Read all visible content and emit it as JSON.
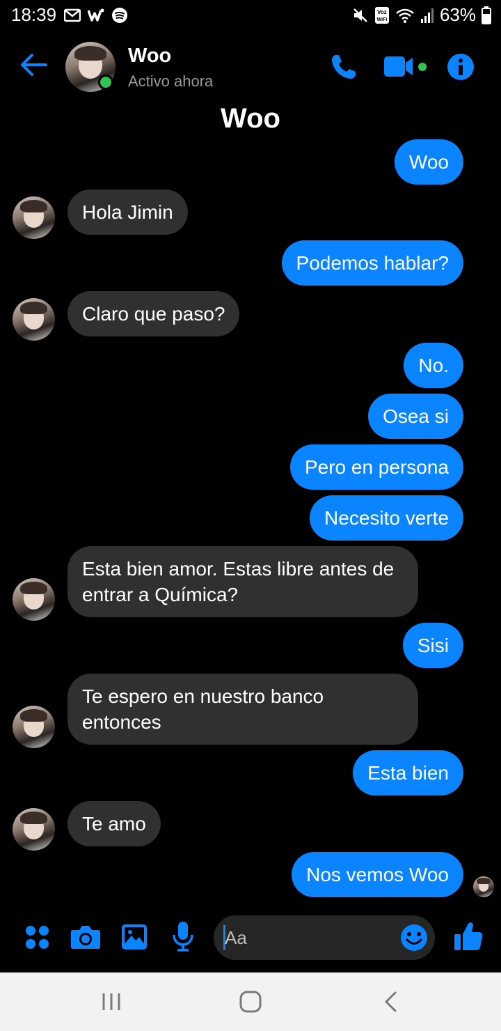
{
  "status_bar": {
    "time": "18:39",
    "battery": "63%",
    "left_icons": [
      "gmail-icon",
      "w-app-icon",
      "spotify-icon"
    ],
    "right_icons": [
      "mute-icon",
      "voz-wifi-icon",
      "wifi-icon",
      "signal-icon",
      "battery-icon"
    ]
  },
  "header": {
    "contact_name": "Woo",
    "status": "Activo ahora",
    "accent_color": "#0a84ff",
    "online_color": "#31c452"
  },
  "conversation_title": "Woo",
  "messages": [
    {
      "from": "me",
      "text": "Woo"
    },
    {
      "from": "them",
      "text": "Hola Jimin"
    },
    {
      "from": "me",
      "text": "Podemos hablar?"
    },
    {
      "from": "them",
      "text": "Claro que paso?"
    },
    {
      "from": "me",
      "text": "No."
    },
    {
      "from": "me",
      "text": "Osea si"
    },
    {
      "from": "me",
      "text": "Pero en persona"
    },
    {
      "from": "me",
      "text": "Necesito verte"
    },
    {
      "from": "them",
      "text": "Esta bien amor. Estas libre antes de entrar a Química?"
    },
    {
      "from": "me",
      "text": "Sisi"
    },
    {
      "from": "them",
      "text": "Te espero en nuestro banco entonces"
    },
    {
      "from": "me",
      "text": "Esta bien"
    },
    {
      "from": "them",
      "text": "Te amo"
    },
    {
      "from": "me",
      "text": "Nos vemos Woo"
    }
  ],
  "composer": {
    "placeholder": "Aa",
    "icons": [
      "apps-icon",
      "camera-icon",
      "gallery-icon",
      "microphone-icon",
      "emoji-icon",
      "thumbs-up-icon"
    ]
  },
  "nav_bar": {
    "icons": [
      "recent-apps-icon",
      "home-icon",
      "back-nav-icon"
    ]
  }
}
